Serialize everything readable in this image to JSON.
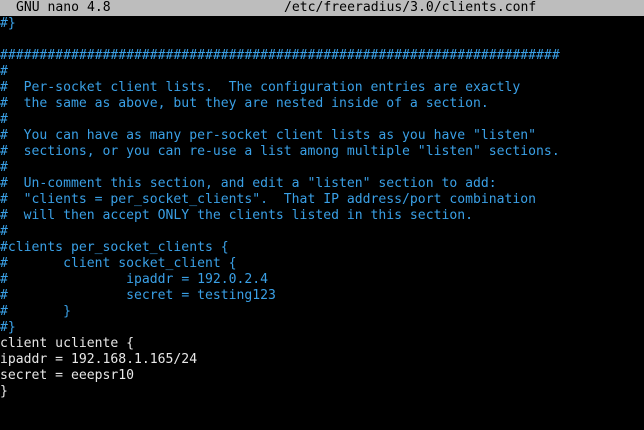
{
  "titlebar": {
    "app_name": "GNU nano 4.8",
    "file_path": "/etc/freeradius/3.0/clients.conf"
  },
  "colors": {
    "comment": "#3aa0e6",
    "text": "#e8e8e8",
    "titlebar_bg": "#bdbdbd",
    "background": "#000000"
  },
  "lines": [
    {
      "text": "#}",
      "type": "comment"
    },
    {
      "text": "",
      "type": "normal"
    },
    {
      "text": "#######################################################################",
      "type": "comment"
    },
    {
      "text": "#",
      "type": "comment"
    },
    {
      "text": "#  Per-socket client lists.  The configuration entries are exactly",
      "type": "comment"
    },
    {
      "text": "#  the same as above, but they are nested inside of a section.",
      "type": "comment"
    },
    {
      "text": "#",
      "type": "comment"
    },
    {
      "text": "#  You can have as many per-socket client lists as you have \"listen\"",
      "type": "comment"
    },
    {
      "text": "#  sections, or you can re-use a list among multiple \"listen\" sections.",
      "type": "comment"
    },
    {
      "text": "#",
      "type": "comment"
    },
    {
      "text": "#  Un-comment this section, and edit a \"listen\" section to add:",
      "type": "comment"
    },
    {
      "text": "#  \"clients = per_socket_clients\".  That IP address/port combination",
      "type": "comment"
    },
    {
      "text": "#  will then accept ONLY the clients listed in this section.",
      "type": "comment"
    },
    {
      "text": "#",
      "type": "comment"
    },
    {
      "text": "#clients per_socket_clients {",
      "type": "comment"
    },
    {
      "text": "#\tclient socket_client {",
      "type": "comment"
    },
    {
      "text": "#\t\tipaddr = 192.0.2.4",
      "type": "comment"
    },
    {
      "text": "#\t\tsecret = testing123",
      "type": "comment"
    },
    {
      "text": "#\t}",
      "type": "comment"
    },
    {
      "text": "#}",
      "type": "comment"
    },
    {
      "text": "client ucliente {",
      "type": "normal"
    },
    {
      "text": "ipaddr = 192.168.1.165/24",
      "type": "normal"
    },
    {
      "text": "secret = eeepsr10",
      "type": "normal"
    },
    {
      "text": "}",
      "type": "normal"
    }
  ]
}
